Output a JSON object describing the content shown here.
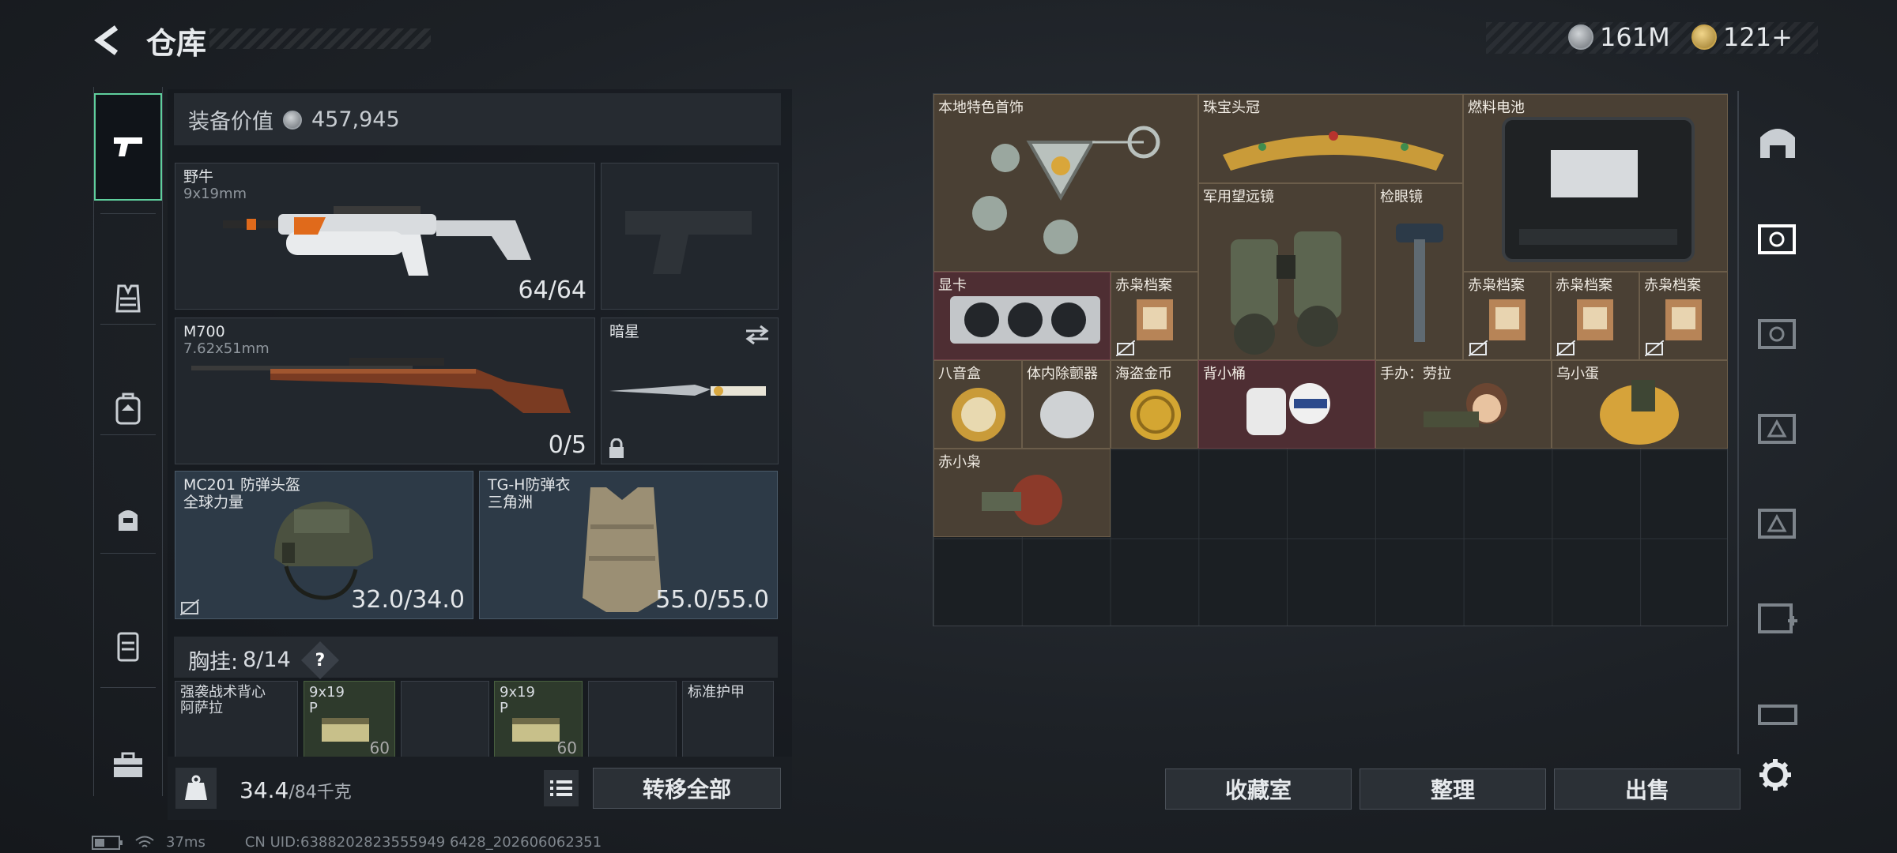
{
  "header": {
    "title": "仓库",
    "coins": "161M",
    "tickets": "121+"
  },
  "equipment": {
    "value_label": "装备价值",
    "value": "457,945",
    "primary": {
      "name": "野牛",
      "caliber": "9x19mm",
      "ammo": "64/64"
    },
    "sidearm": {
      "name": ""
    },
    "secondary": {
      "name": "M700",
      "caliber": "7.62x51mm",
      "ammo": "0/5"
    },
    "melee": {
      "name": "暗星"
    },
    "helmet": {
      "name": "MC201 防弹头盔",
      "sub": "全球力量",
      "durability": "32.0/34.0"
    },
    "armor": {
      "name": "TG-H防弹衣",
      "sub": "三角洲",
      "durability": "55.0/55.0"
    },
    "chest_rig": {
      "label": "胸挂:",
      "capacity": "8/14",
      "help": "?"
    },
    "rig_slots": [
      {
        "name": "强袭战术背心",
        "sub": "阿萨拉",
        "count": ""
      },
      {
        "name": "9x19",
        "sub": "P",
        "count": "60"
      },
      {
        "name": "",
        "sub": "",
        "count": ""
      },
      {
        "name": "9x19",
        "sub": "P",
        "count": "60"
      },
      {
        "name": "",
        "sub": "",
        "count": ""
      },
      {
        "name": "标准护甲",
        "sub": "",
        "count": ""
      }
    ]
  },
  "footer": {
    "weight": "34.4",
    "weight_max": "/84千克",
    "transfer_all": "转移全部"
  },
  "storage": {
    "items": [
      {
        "label": "本地特色首饰"
      },
      {
        "label": "珠宝头冠"
      },
      {
        "label": "燃料电池"
      },
      {
        "label": "军用望远镜"
      },
      {
        "label": "检眼镜"
      },
      {
        "label": "显卡"
      },
      {
        "label": "赤枭档案"
      },
      {
        "label": "赤枭档案"
      },
      {
        "label": "赤枭档案"
      },
      {
        "label": "赤枭档案"
      },
      {
        "label": "八音盒"
      },
      {
        "label": "体内除颤器"
      },
      {
        "label": "海盗金币"
      },
      {
        "label": "背小桶"
      },
      {
        "label": "手办：劳拉"
      },
      {
        "label": "乌小蛋"
      },
      {
        "label": "赤小枭"
      }
    ],
    "buttons": {
      "collection": "收藏室",
      "sort": "整理",
      "sell": "出售"
    }
  },
  "status": {
    "ping": "37ms",
    "uid": "CN UID:6388202823555949 6428_202606062351"
  },
  "colors": {
    "accent": "#5fcf9d",
    "item_bg": "#4a4034",
    "item_red": "#4e2e33"
  }
}
